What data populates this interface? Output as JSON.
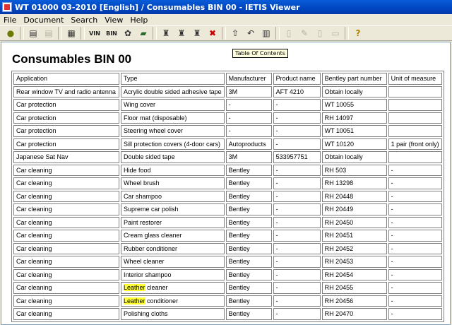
{
  "window": {
    "title": "WT 01000 03-2010 [English] / Consumables BIN 00 - IETIS Viewer"
  },
  "menu": [
    "File",
    "Document",
    "Search",
    "View",
    "Help"
  ],
  "toolbar": {
    "vin_label": "VIN",
    "bin_label": "BIN"
  },
  "tooltip": "Table Of Contents",
  "page": {
    "title": "Consumables BIN 00"
  },
  "table": {
    "headers": [
      "Application",
      "Type",
      "Manufacturer",
      "Product name",
      "Bentley part number",
      "Unit of measure"
    ],
    "highlight_term": "Leather",
    "rows": [
      {
        "application": "Rear window TV and radio antenna",
        "type": "Acrylic double sided adhesive tape",
        "manufacturer": "3M",
        "product": "AFT 4210",
        "part": "Obtain locally",
        "unit": ""
      },
      {
        "application": "Car protection",
        "type": "Wing cover",
        "manufacturer": "-",
        "product": "-",
        "part": "WT 10055",
        "unit": ""
      },
      {
        "application": "Car protection",
        "type": "Floor mat (disposable)",
        "manufacturer": "-",
        "product": "-",
        "part": "RH 14097",
        "unit": ""
      },
      {
        "application": "Car protection",
        "type": "Steering wheel cover",
        "manufacturer": "-",
        "product": "-",
        "part": "WT 10051",
        "unit": ""
      },
      {
        "application": "Car protection",
        "type": "Sill protection covers (4-door cars)",
        "manufacturer": "Autoproducts",
        "product": "-",
        "part": "WT 10120",
        "unit": "1 pair (front only)"
      },
      {
        "application": "Japanese Sat Nav",
        "type": "Double sided tape",
        "manufacturer": "3M",
        "product": "533957751",
        "part": "Obtain locally",
        "unit": ""
      },
      {
        "application": "Car cleaning",
        "type": "Hide food",
        "manufacturer": "Bentley",
        "product": "-",
        "part": "RH 503",
        "unit": "-"
      },
      {
        "application": "Car cleaning",
        "type": "Wheel brush",
        "manufacturer": "Bentley",
        "product": "-",
        "part": "RH 13298",
        "unit": "-"
      },
      {
        "application": "Car cleaning",
        "type": "Car shampoo",
        "manufacturer": "Bentley",
        "product": "-",
        "part": "RH 20448",
        "unit": "-"
      },
      {
        "application": "Car cleaning",
        "type": "Supreme car polish",
        "manufacturer": "Bentley",
        "product": "-",
        "part": "RH 20449",
        "unit": "-"
      },
      {
        "application": "Car cleaning",
        "type": "Paint restorer",
        "manufacturer": "Bentley",
        "product": "-",
        "part": "RH 20450",
        "unit": "-"
      },
      {
        "application": "Car cleaning",
        "type": "Cream glass cleaner",
        "manufacturer": "Bentley",
        "product": "-",
        "part": "RH 20451",
        "unit": "-"
      },
      {
        "application": "Car cleaning",
        "type": "Rubber conditioner",
        "manufacturer": "Bentley",
        "product": "-",
        "part": "RH 20452",
        "unit": "-"
      },
      {
        "application": "Car cleaning",
        "type": "Wheel cleaner",
        "manufacturer": "Bentley",
        "product": "-",
        "part": "RH 20453",
        "unit": "-"
      },
      {
        "application": "Car cleaning",
        "type": "Interior shampoo",
        "manufacturer": "Bentley",
        "product": "-",
        "part": "RH 20454",
        "unit": "-"
      },
      {
        "application": "Car cleaning",
        "type": "Leather cleaner",
        "manufacturer": "Bentley",
        "product": "-",
        "part": "RH 20455",
        "unit": "-"
      },
      {
        "application": "Car cleaning",
        "type": "Leather conditioner",
        "manufacturer": "Bentley",
        "product": "-",
        "part": "RH 20456",
        "unit": "-"
      },
      {
        "application": "Car cleaning",
        "type": "Polishing cloths",
        "manufacturer": "Bentley",
        "product": "-",
        "part": "RH 20470",
        "unit": "-"
      }
    ]
  }
}
